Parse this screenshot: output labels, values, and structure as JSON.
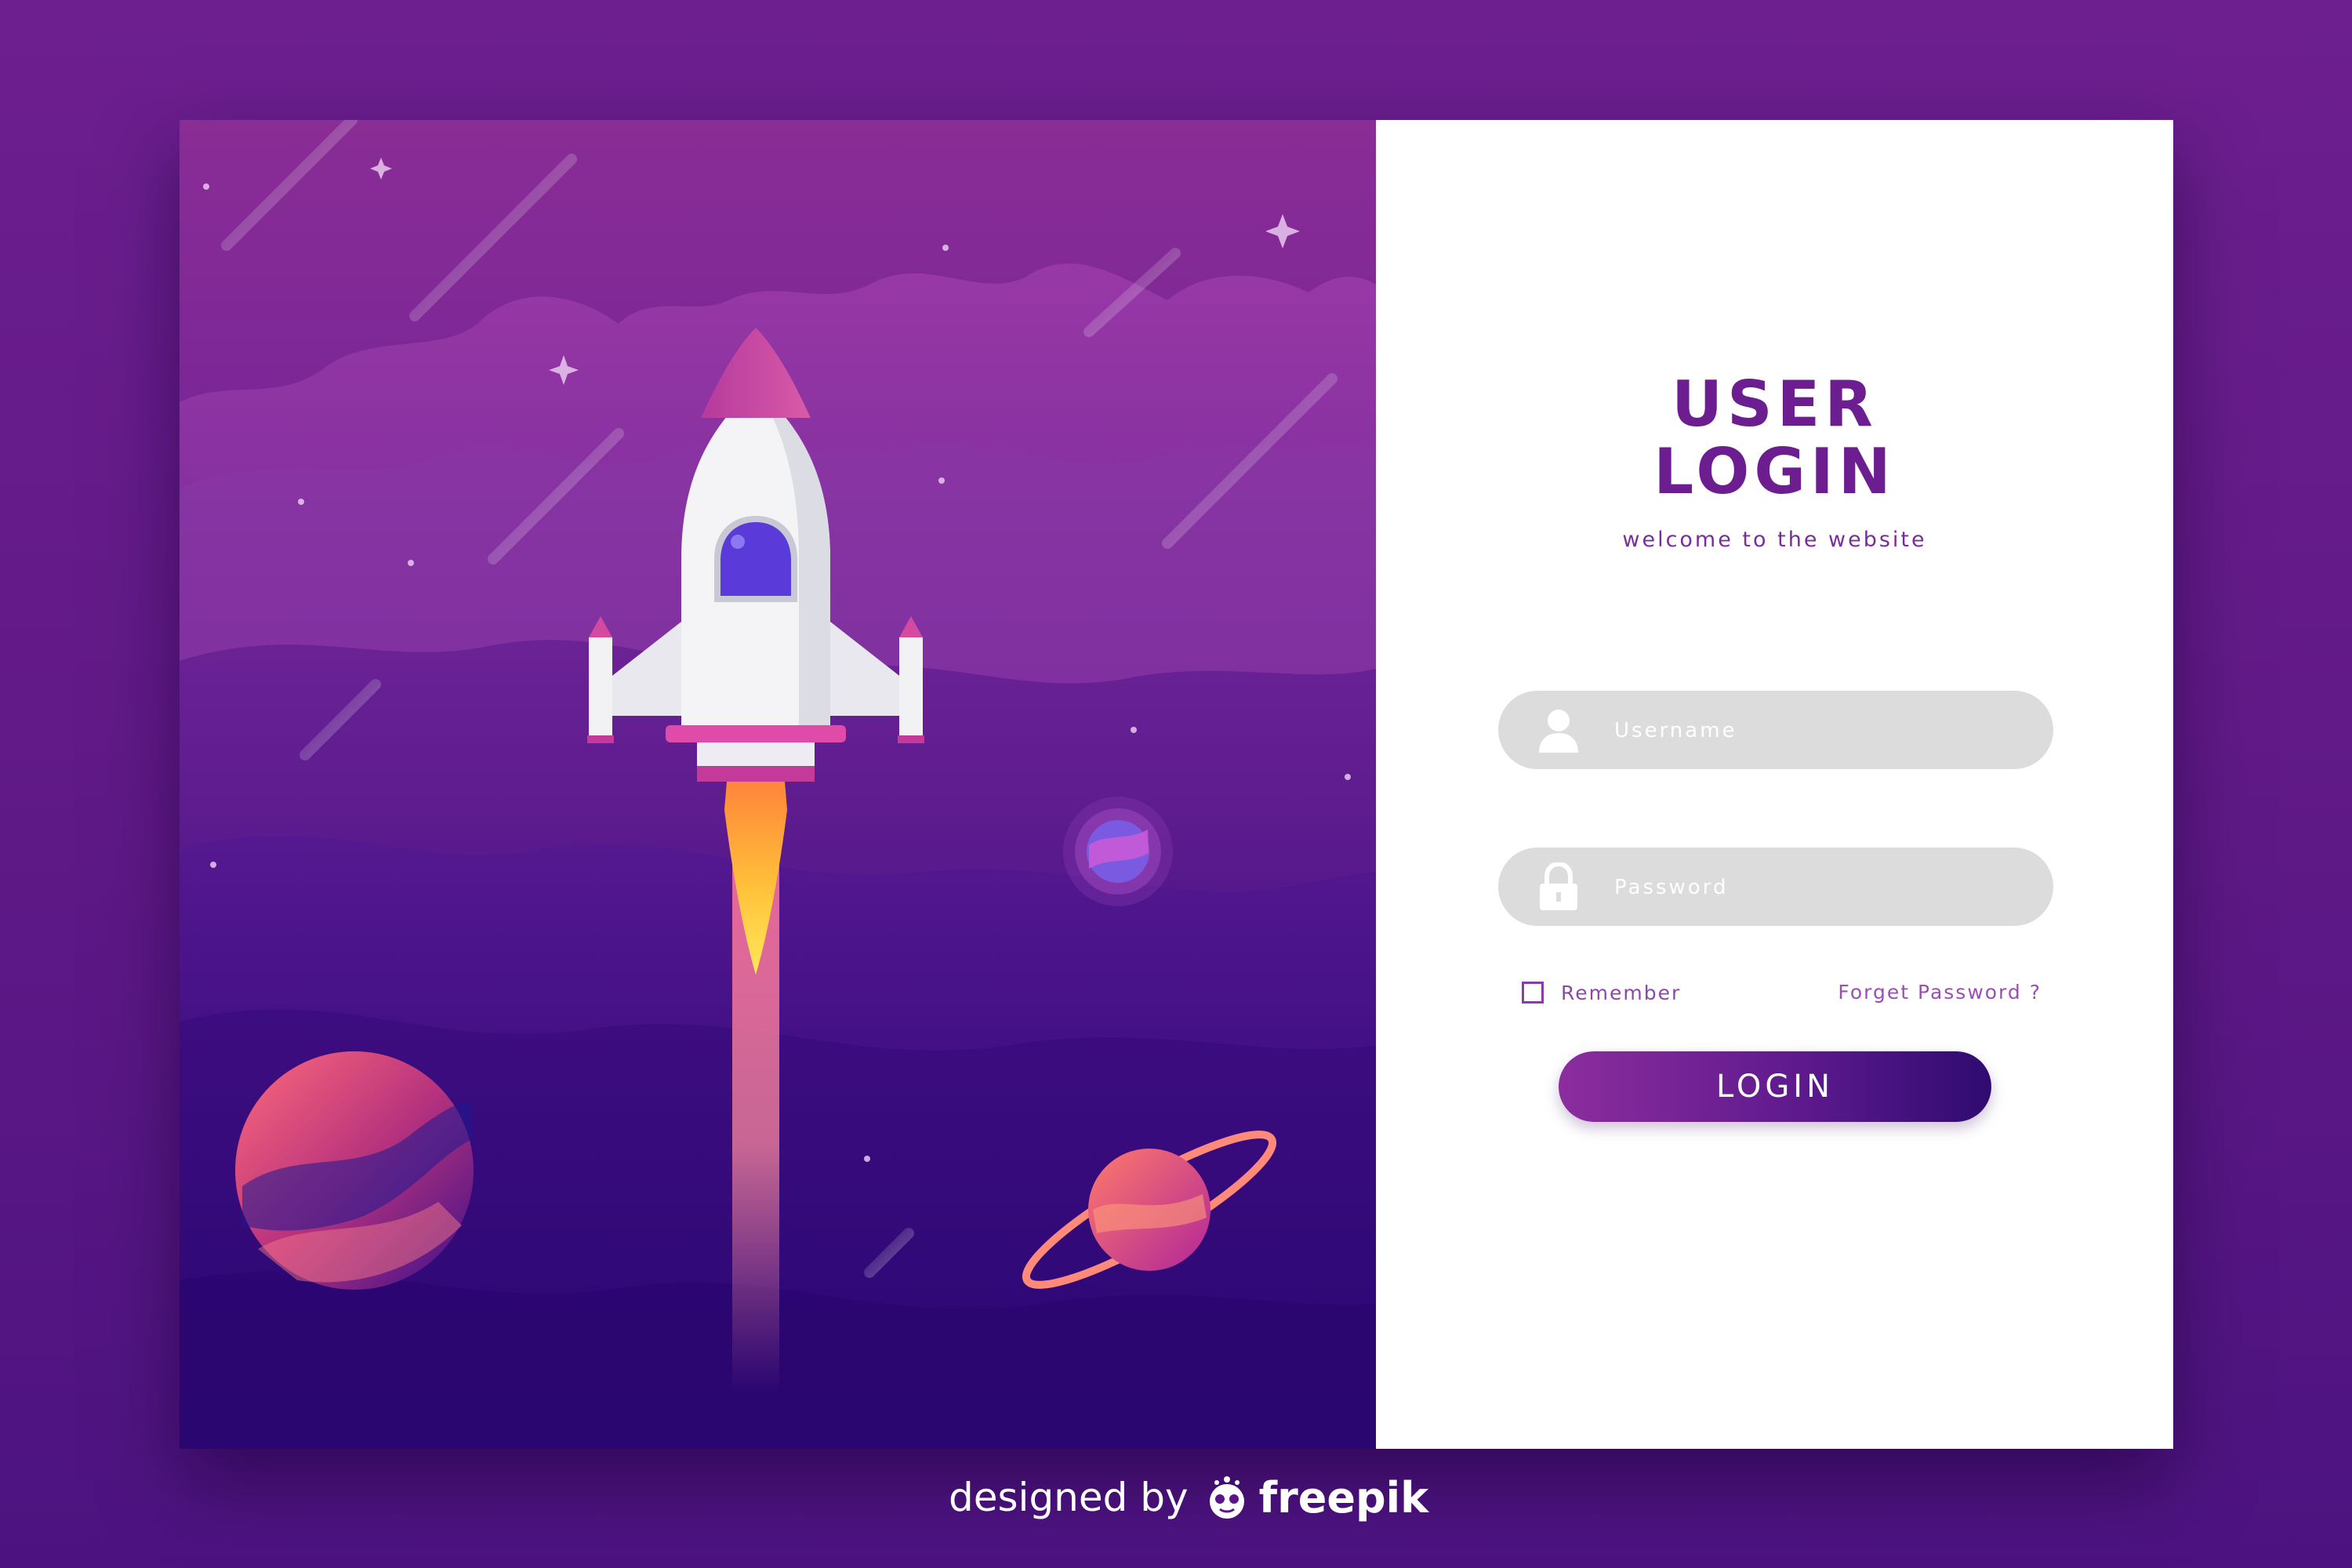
{
  "login": {
    "title_line1": "USER",
    "title_line2": "LOGIN",
    "subtitle": "welcome to the website",
    "username_placeholder": "Username",
    "password_placeholder": "Password",
    "remember_label": "Remember",
    "remember_checked": false,
    "forgot_label": "Forget Password ?",
    "login_button": "LOGIN"
  },
  "credit": {
    "prefix": "designed by",
    "brand": "freepik"
  },
  "icons": {
    "username": "user-icon",
    "password": "lock-icon",
    "brand": "freepik-logo"
  },
  "colors": {
    "accent": "#6c1d8f",
    "field_bg": "#dcdcdc",
    "button_start": "#8c2d9e",
    "button_end": "#2f0b70",
    "page_bg": "#621a88"
  }
}
